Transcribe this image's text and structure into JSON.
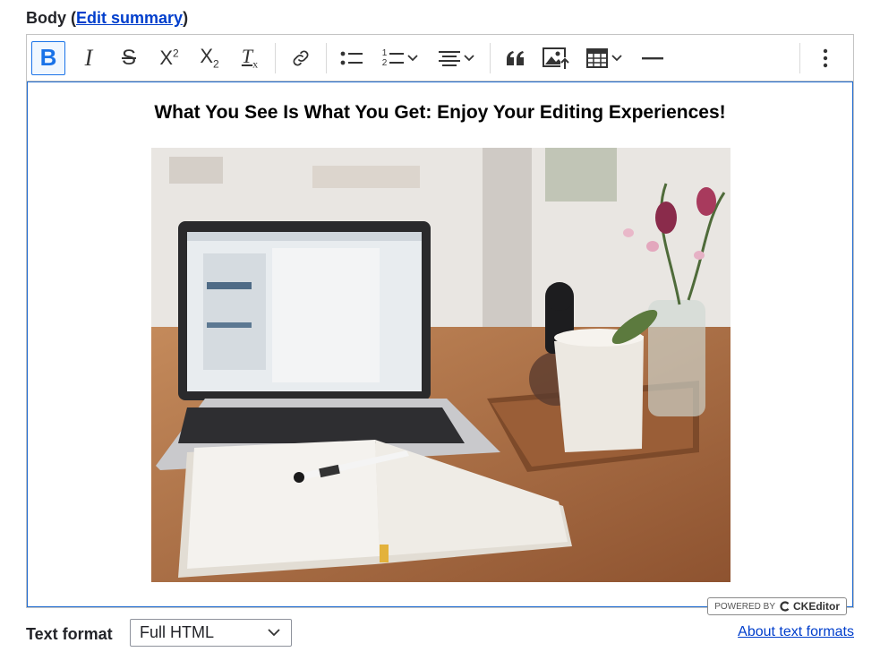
{
  "field": {
    "label": "Body",
    "open_paren": "(",
    "link": "Edit summary",
    "close_paren": ")"
  },
  "toolbar": {
    "buttons": [
      {
        "name": "bold",
        "icon": "bold-icon",
        "label": "B",
        "active": true
      },
      {
        "name": "italic",
        "icon": "italic-icon",
        "label": "I"
      },
      {
        "name": "strikethrough",
        "icon": "strikethrough-icon",
        "label": "S"
      },
      {
        "name": "superscript",
        "icon": "superscript-icon",
        "label": "X",
        "sup": "2"
      },
      {
        "name": "subscript",
        "icon": "subscript-icon",
        "label": "X",
        "sub": "2"
      },
      {
        "name": "remove-format",
        "icon": "remove-format-icon",
        "label": "T",
        "sub": "x"
      },
      {
        "name": "link",
        "icon": "link-icon"
      },
      {
        "name": "bulleted-list",
        "icon": "bulleted-list-icon"
      },
      {
        "name": "numbered-list",
        "icon": "numbered-list-icon",
        "dropdown": true,
        "numbers": [
          "1",
          "2"
        ]
      },
      {
        "name": "alignment",
        "icon": "align-center-icon",
        "dropdown": true
      },
      {
        "name": "block-quote",
        "icon": "quote-icon"
      },
      {
        "name": "insert-image",
        "icon": "image-upload-icon"
      },
      {
        "name": "insert-table",
        "icon": "table-icon",
        "dropdown": true
      },
      {
        "name": "horizontal-line",
        "icon": "horizontal-line-icon"
      },
      {
        "name": "more",
        "icon": "vertical-dots-icon"
      }
    ]
  },
  "content": {
    "heading": "What You See Is What You Get: Enjoy Your Editing Experiences!",
    "image": {
      "subject": "laptop-notebook-coffee-photo"
    }
  },
  "powered": {
    "prefix": "POWERED BY",
    "brand": "CKEditor"
  },
  "text_format": {
    "label": "Text format",
    "selected": "Full HTML",
    "about_link": "About text formats"
  },
  "colors": {
    "link": "#003ecc",
    "focus_border": "#1f6bd1",
    "active_button": "#1a73e8"
  }
}
